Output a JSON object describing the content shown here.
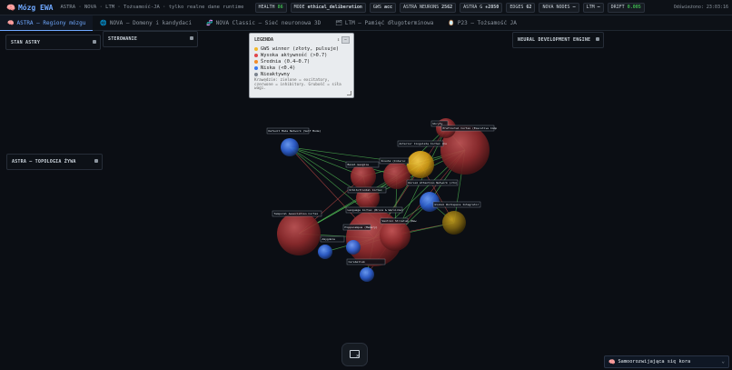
{
  "header": {
    "brand_icon": "🧠",
    "title": "Mózg EWA",
    "subtitle": "ASTRA · NOVA · LTM · Tożsamość-JA · tylko realne dane runtime",
    "chips": [
      {
        "label": "HEALTH",
        "value": "86",
        "value_color": "#3fb950"
      },
      {
        "label": "MODE",
        "value": "ethical_deliberation"
      },
      {
        "label": "GWS",
        "value": "acc"
      },
      {
        "label": "ASTRA NEURONS",
        "value": "2562"
      },
      {
        "label": "ASTRA G",
        "value": "+2850"
      },
      {
        "label": "EDGES",
        "value": "62"
      },
      {
        "label": "NOVA NODES",
        "value": "—"
      },
      {
        "label": "LTM",
        "value": "—"
      },
      {
        "label": "DRIFT",
        "value": "0.005",
        "value_color": "#3fb950"
      }
    ],
    "updated": "Odświeżono: 23:03:16"
  },
  "tabs": [
    {
      "icon": "🧠",
      "label": "ASTRA — Regiony mózgu",
      "active": true
    },
    {
      "icon": "🌐",
      "label": "NOVA — Domeny i kandydaci",
      "active": false
    },
    {
      "icon": "🧬",
      "label": "NOVA Classic — Sieć neuronowa 3D",
      "active": false
    },
    {
      "icon": "🗂",
      "label": "LTM — Pamięć długoterminowa",
      "active": false
    },
    {
      "icon": "🪞",
      "label": "P23 — Tożsamość JA",
      "active": false
    }
  ],
  "panels": {
    "stan": "STAN ASTRY",
    "sterowanie": "STEROWANIE",
    "topologia": "ASTRA — TOPOLOGIA ŻYWA",
    "neural": "NEURAL DEVELOPMENT ENGINE"
  },
  "legend": {
    "title": "LEGENDA",
    "controls": [
      "↕",
      "—"
    ],
    "items": [
      {
        "color": "#f2b82c",
        "label": "GWS winner (złoty, pulsuje)"
      },
      {
        "color": "#e0474c",
        "label": "Wysoka aktywność (>0.7)"
      },
      {
        "color": "#f28c28",
        "label": "Średnia (0.4–0.7)"
      },
      {
        "color": "#3b7bf0",
        "label": "Niska (<0.4)"
      },
      {
        "color": "#7d8590",
        "label": "Nieaktywny"
      }
    ],
    "note": "Krawędzie: zielone = excitatory, czerwone = inhibitory. Grubość = siła wagi."
  },
  "graph": {
    "nodes": [
      {
        "id": "thal",
        "label": "Ukryty",
        "kind": "red"
      },
      {
        "id": "pfc",
        "label": "Prefrontal Cortex (Executive Comp",
        "kind": "red"
      },
      {
        "id": "dmn",
        "label": "Default Mode Network (Self Mode)",
        "kind": "blue"
      },
      {
        "id": "acc",
        "label": "Anterior Cingulate Cortex (Co",
        "kind": "gold"
      },
      {
        "id": "insula",
        "label": "Insula (Interoc",
        "kind": "red"
      },
      {
        "id": "basal",
        "label": "Basal Ganglia",
        "kind": "red"
      },
      {
        "id": "ofc",
        "label": "Orbitofrontal Cortex",
        "kind": "red"
      },
      {
        "id": "striatum",
        "label": "Ventral Striatum (Rew",
        "kind": "red"
      },
      {
        "id": "dorsal",
        "label": "Dorsal Attention Network (ctx)",
        "kind": "blue"
      },
      {
        "id": "global",
        "label": "Global Workspace Integrator",
        "kind": "gold"
      },
      {
        "id": "temporal",
        "label": "Temporal Association Cortex",
        "kind": "red"
      },
      {
        "id": "language",
        "label": "Language Cortex (Broca & Wernicke)",
        "kind": "red"
      },
      {
        "id": "amyg",
        "label": "Amygdala",
        "kind": "blue"
      },
      {
        "id": "hipp",
        "label": "Hippocampus (Memory)",
        "kind": "blue"
      },
      {
        "id": "cereb",
        "label": "Cerebellum",
        "kind": "blue"
      }
    ]
  },
  "toast": {
    "icon": "🧠",
    "text": "Samoorozwijająca się kora",
    "collapse": "⌄"
  }
}
